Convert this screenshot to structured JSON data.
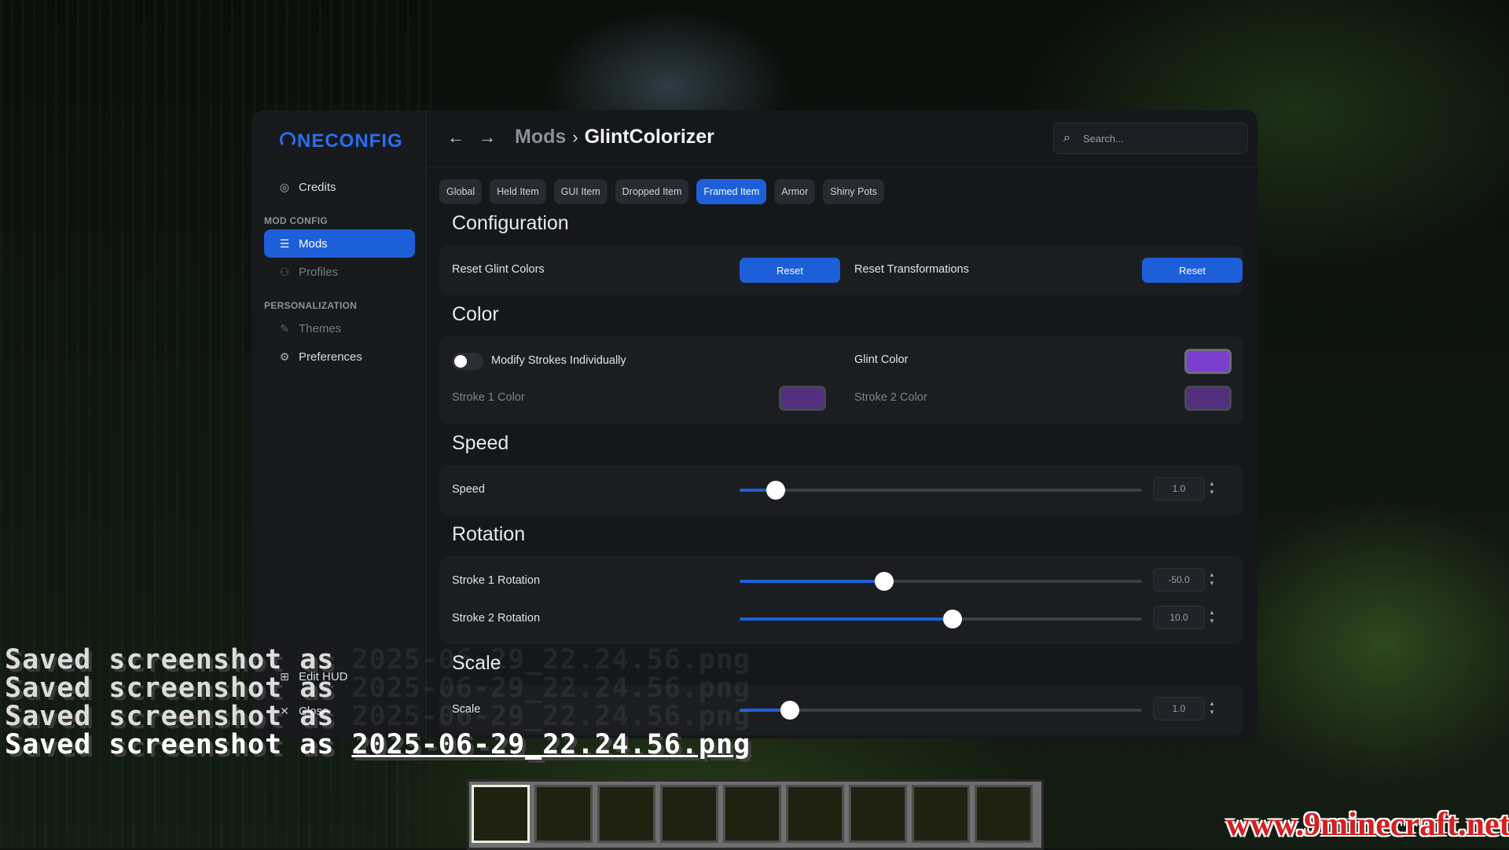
{
  "app": {
    "logo": "NECONFIG"
  },
  "sidebar": {
    "credits": "Credits",
    "section_mod_config": "MOD CONFIG",
    "mods": "Mods",
    "profiles": "Profiles",
    "section_personalization": "PERSONALIZATION",
    "themes": "Themes",
    "preferences": "Preferences",
    "edit_hud": "Edit HUD",
    "close": "Close"
  },
  "breadcrumb": {
    "parent": "Mods",
    "current": "GlintColorizer"
  },
  "search": {
    "placeholder": "Search..."
  },
  "tabs": [
    "Global",
    "Held Item",
    "GUI Item",
    "Dropped Item",
    "Framed Item",
    "Armor",
    "Shiny Pots"
  ],
  "active_tab": "Framed Item",
  "configuration": {
    "heading": "Configuration",
    "reset_glint_label": "Reset Glint Colors",
    "reset_glint_button": "Reset",
    "reset_transform_label": "Reset Transformations",
    "reset_transform_button": "Reset"
  },
  "color": {
    "heading": "Color",
    "modify_strokes_label": "Modify Strokes Individually",
    "modify_strokes_on": false,
    "glint_color_label": "Glint Color",
    "glint_color": "#7b3fd0",
    "stroke1_label": "Stroke 1 Color",
    "stroke1_color": "#53307f",
    "stroke2_label": "Stroke 2 Color",
    "stroke2_color": "#53307f"
  },
  "speed": {
    "heading": "Speed",
    "label": "Speed",
    "value": "1.0",
    "fraction": 0.09
  },
  "rotation": {
    "heading": "Rotation",
    "stroke1_label": "Stroke 1 Rotation",
    "stroke1_value": "-50.0",
    "stroke1_fraction": 0.36,
    "stroke2_label": "Stroke 2 Rotation",
    "stroke2_value": "10.0",
    "stroke2_fraction": 0.53
  },
  "scale": {
    "heading": "Scale",
    "label": "Scale",
    "value": "1.0",
    "fraction": 0.125
  },
  "chat": {
    "prefix": "Saved screenshot as ",
    "filename": "2025-06-29_22.24.56.png"
  },
  "hotbar": {
    "slots": 9,
    "selected": 0
  },
  "watermark": "www.9minecraft.net",
  "colors": {
    "accent": "#1d5fd9",
    "panel": "#15171b",
    "card": "#1b1d21"
  }
}
